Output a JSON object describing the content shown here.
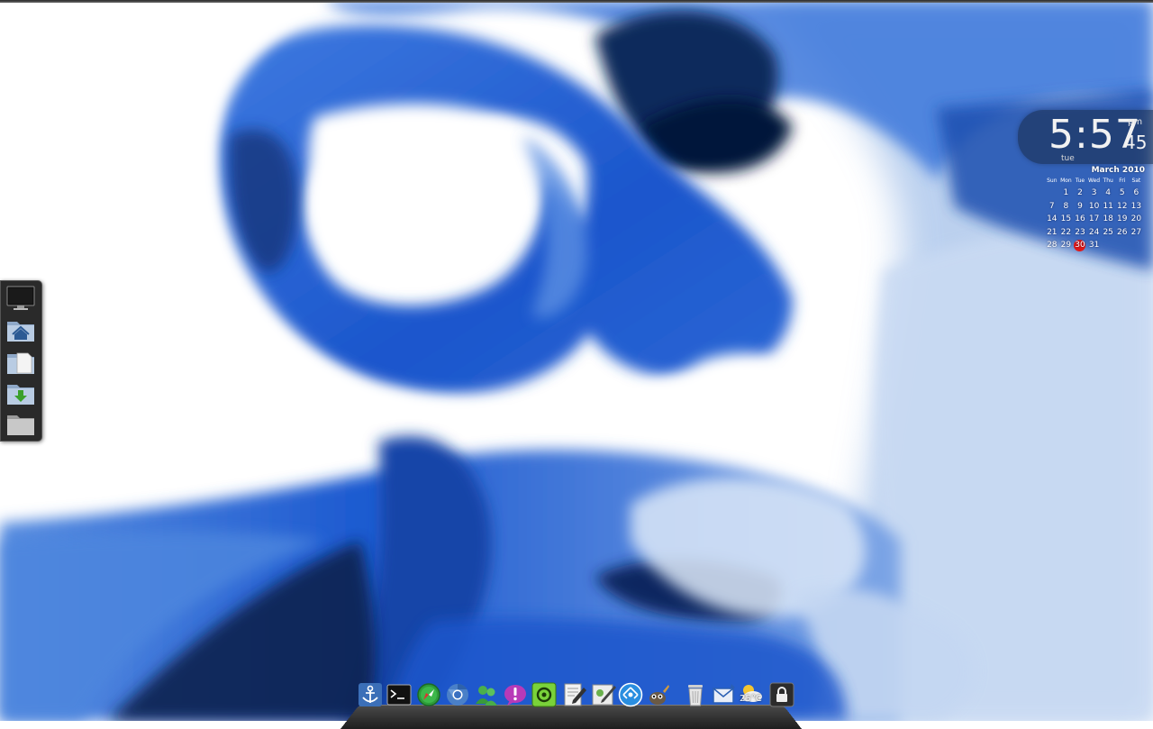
{
  "clock": {
    "time": "5:57",
    "ampm": "pm",
    "seconds": "45",
    "day": "tue"
  },
  "calendar": {
    "month_title": "March 2010",
    "weekdays": [
      "Sun",
      "Mon",
      "Tue",
      "Wed",
      "Thu",
      "Fri",
      "Sat"
    ],
    "weeks": [
      [
        "",
        "1",
        "2",
        "3",
        "4",
        "5",
        "6"
      ],
      [
        "7",
        "8",
        "9",
        "10",
        "11",
        "12",
        "13"
      ],
      [
        "14",
        "15",
        "16",
        "17",
        "18",
        "19",
        "20"
      ],
      [
        "21",
        "22",
        "23",
        "24",
        "25",
        "26",
        "27"
      ],
      [
        "28",
        "29",
        "30",
        "31",
        "",
        "",
        ""
      ]
    ],
    "today": "30",
    "today_color": "#e01818"
  },
  "places": [
    {
      "icon": "monitor-icon"
    },
    {
      "icon": "home-folder-icon"
    },
    {
      "icon": "documents-folder-icon"
    },
    {
      "icon": "downloads-folder-icon"
    },
    {
      "icon": "folder-icon"
    }
  ],
  "dock": {
    "items": [
      {
        "icon": "anchor-icon"
      },
      {
        "icon": "terminal-icon"
      },
      {
        "icon": "compass-icon"
      },
      {
        "icon": "chromium-icon"
      },
      {
        "icon": "contacts-icon"
      },
      {
        "icon": "notification-icon"
      },
      {
        "icon": "recycle-icon"
      },
      {
        "icon": "text-editor-icon"
      },
      {
        "icon": "image-editor-icon"
      },
      {
        "icon": "network-icon"
      },
      {
        "icon": "gimp-icon"
      },
      {
        "icon": "trash-icon"
      },
      {
        "icon": "mail-icon"
      },
      {
        "icon": "weather-icon"
      },
      {
        "icon": "lock-icon"
      }
    ],
    "weather_temp": "25°C"
  },
  "colors": {
    "wallpaper_blue": "#1d5fd6",
    "wallpaper_dark": "#0a2a5e",
    "accent_today": "#e01818"
  }
}
